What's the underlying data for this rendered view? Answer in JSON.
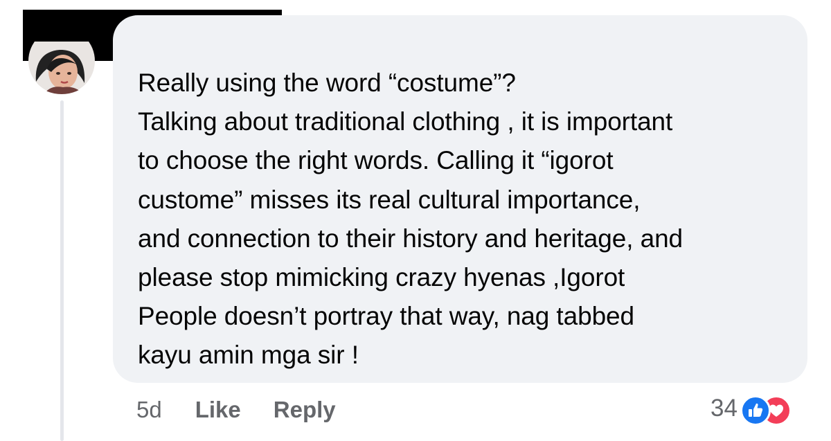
{
  "comment": {
    "author": "",
    "lines": [
      "Really using the word “costume”?",
      "Talking about traditional clothing , it is important",
      "to choose the right words. Calling it “igorot",
      "custome” misses its real cultural importance,",
      "and connection to their history and heritage, and",
      "please stop mimicking crazy hyenas ,Igorot",
      "People doesn’t portray that way, nag tabbed",
      "kayu amin mga sir !"
    ],
    "time": "5d",
    "like_label": "Like",
    "reply_label": "Reply",
    "reaction_count": "34",
    "reactions": [
      "like-icon",
      "love-icon"
    ]
  },
  "colors": {
    "bubble": "#f0f2f5",
    "meta_text": "#65676b",
    "like_blue": "#1877f2",
    "love_red": "#f33e58"
  }
}
